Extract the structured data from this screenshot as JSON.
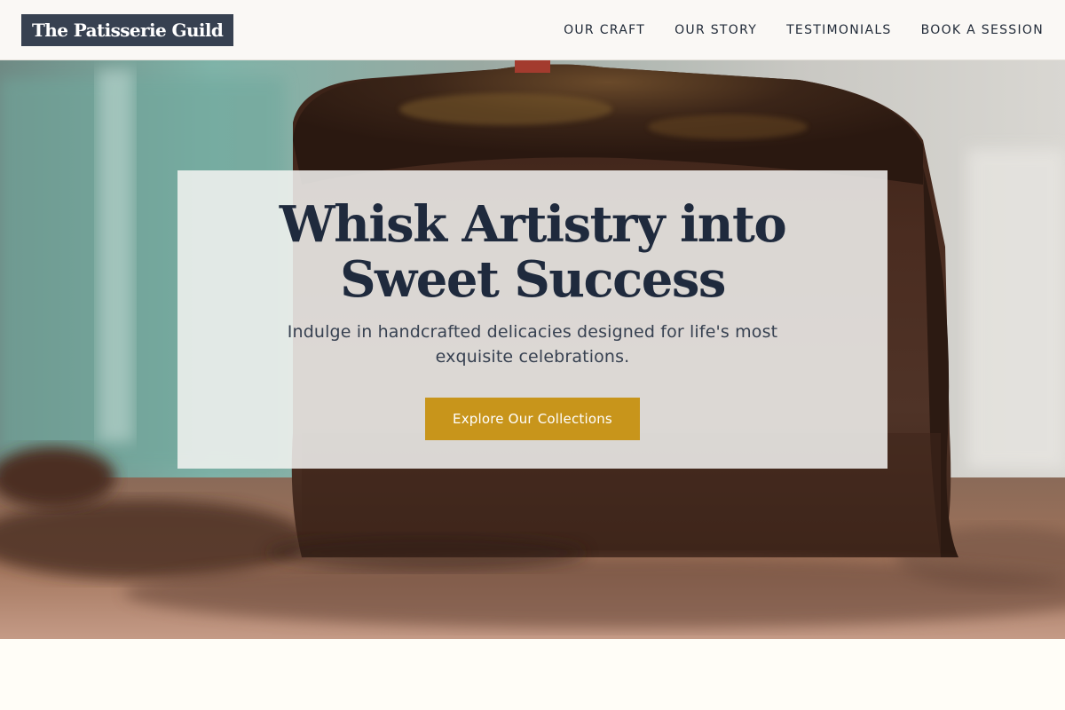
{
  "header": {
    "logo_text": "The Patisserie Guild",
    "nav": [
      {
        "label": "OUR CRAFT"
      },
      {
        "label": "OUR STORY"
      },
      {
        "label": "TESTIMONIALS"
      },
      {
        "label": "BOOK A SESSION"
      }
    ]
  },
  "hero": {
    "title": "Whisk Artistry into Sweet Success",
    "subtitle": "Indulge in handcrafted delicacies designed for life's most exquisite celebrations.",
    "cta_label": "Explore Our Collections"
  },
  "colors": {
    "logo_bg": "#374151",
    "cta_bg": "#c8951b",
    "title_text": "#1f2a3d",
    "page_bg": "#fffdf7"
  }
}
